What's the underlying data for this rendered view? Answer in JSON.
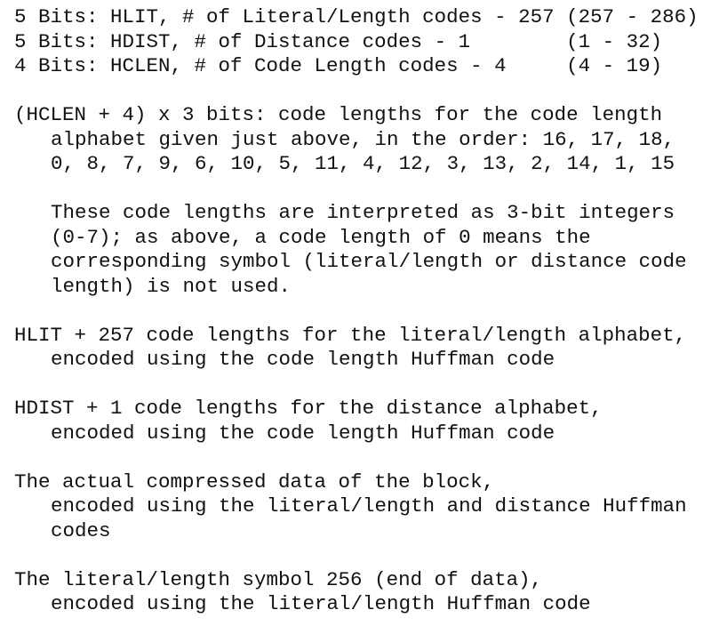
{
  "header_fields": [
    "5 Bits: HLIT, # of Literal/Length codes - 257 (257 - 286)",
    "5 Bits: HDIST, # of Distance codes - 1        (1 - 32)",
    "4 Bits: HCLEN, # of Code Length codes - 4     (4 - 19)"
  ],
  "code_length_order": [
    "(HCLEN + 4) x 3 bits: code lengths for the code length",
    "alphabet given just above, in the order: 16, 17, 18,",
    "0, 8, 7, 9, 6, 10, 5, 11, 4, 12, 3, 13, 2, 14, 1, 15"
  ],
  "code_length_note": [
    "These code lengths are interpreted as 3-bit integers",
    "(0-7); as above, a code length of 0 means the",
    "corresponding symbol (literal/length or distance code",
    "length) is not used."
  ],
  "hlit_codes": [
    "HLIT + 257 code lengths for the literal/length alphabet,",
    "encoded using the code length Huffman code"
  ],
  "hdist_codes": [
    "HDIST + 1 code lengths for the distance alphabet,",
    "encoded using the code length Huffman code"
  ],
  "compressed_data": [
    "The actual compressed data of the block,",
    "encoded using the literal/length and distance Huffman",
    "codes"
  ],
  "end_of_block": [
    "The literal/length symbol 256 (end of data),",
    "encoded using the literal/length Huffman code"
  ]
}
